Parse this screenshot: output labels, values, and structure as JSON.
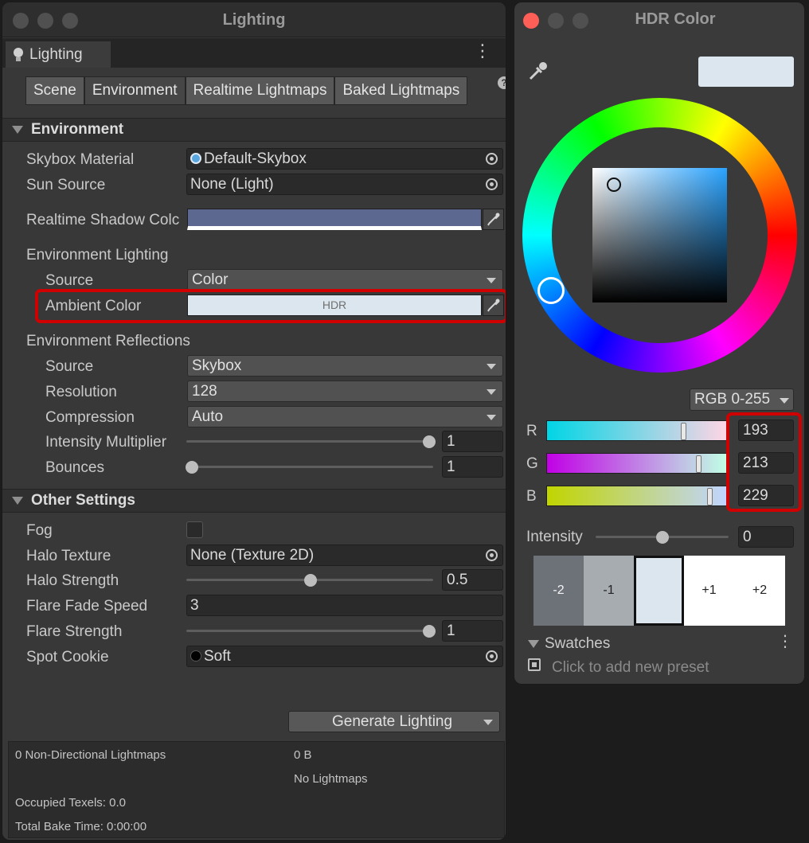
{
  "lighting_window": {
    "title": "Lighting",
    "tab_label": "Lighting",
    "toolbar": [
      "Scene",
      "Environment",
      "Realtime Lightmaps",
      "Baked Lightmaps"
    ],
    "help_glyph": "?",
    "environment": {
      "header": "Environment",
      "skybox_material": {
        "label": "Skybox Material",
        "value": "Default-Skybox"
      },
      "sun_source": {
        "label": "Sun Source",
        "value": "None (Light)"
      },
      "realtime_shadow_color": {
        "label": "Realtime Shadow Colc",
        "color": "#5d6891"
      },
      "env_lighting": {
        "label": "Environment Lighting",
        "source": {
          "label": "Source",
          "value": "Color"
        },
        "ambient_color": {
          "label": "Ambient Color",
          "badge": "HDR",
          "color": "#dce6ef"
        }
      },
      "env_reflections": {
        "label": "Environment Reflections",
        "source": {
          "label": "Source",
          "value": "Skybox"
        },
        "resolution": {
          "label": "Resolution",
          "value": "128"
        },
        "compression": {
          "label": "Compression",
          "value": "Auto"
        },
        "intensity_multiplier": {
          "label": "Intensity Multiplier",
          "value": "1"
        },
        "bounces": {
          "label": "Bounces",
          "value": "1"
        }
      }
    },
    "other_settings": {
      "header": "Other Settings",
      "fog": {
        "label": "Fog",
        "checked": false
      },
      "halo_texture": {
        "label": "Halo Texture",
        "value": "None (Texture 2D)"
      },
      "halo_strength": {
        "label": "Halo Strength",
        "value": "0.5"
      },
      "flare_fade_speed": {
        "label": "Flare Fade Speed",
        "value": "3"
      },
      "flare_strength": {
        "label": "Flare Strength",
        "value": "1"
      },
      "spot_cookie": {
        "label": "Spot Cookie",
        "value": "Soft"
      }
    },
    "generate_button": "Generate Lighting",
    "stats": {
      "non_directional": "0 Non-Directional Lightmaps",
      "size": "0 B",
      "no_lightmaps": "No Lightmaps",
      "occupied_texels": "Occupied Texels: 0.0",
      "total_bake_time": "Total Bake Time: 0:00:00"
    }
  },
  "hdr_window": {
    "title": "HDR Color",
    "preview_color": "#dce6ef",
    "mode": "RGB 0-255",
    "channels": [
      {
        "label": "R",
        "value": "193"
      },
      {
        "label": "G",
        "value": "213"
      },
      {
        "label": "B",
        "value": "229"
      }
    ],
    "intensity": {
      "label": "Intensity",
      "value": "0"
    },
    "exposure_steps": [
      "-2",
      "-1",
      "",
      "+1",
      "+2"
    ],
    "swatches": {
      "label": "Swatches",
      "hint": "Click to add new preset"
    }
  },
  "colors": {
    "highlight": "#d10000",
    "window_bg": "#383838",
    "ambient": "#dce6ef",
    "shadow": "#5d6891"
  }
}
